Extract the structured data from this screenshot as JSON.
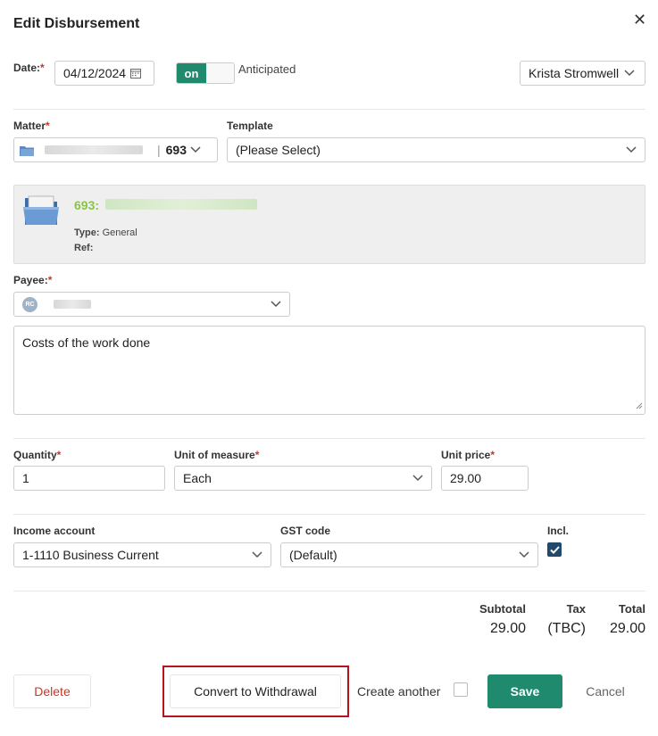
{
  "dialog": {
    "title": "Edit Disbursement"
  },
  "date": {
    "label": "Date:",
    "required": "*",
    "value": "04/12/2024"
  },
  "anticipated": {
    "toggle_label": "on",
    "label": "Anticipated"
  },
  "user_select": {
    "value": "Krista Stromwell"
  },
  "matter": {
    "label": "Matter",
    "required": "*",
    "number": "693"
  },
  "template": {
    "label": "Template",
    "value": "(Please Select)"
  },
  "matter_panel": {
    "code": "693:",
    "type_label": "Type:",
    "type_value": "General",
    "ref_label": "Ref:"
  },
  "payee": {
    "label": "Payee:",
    "required": "*",
    "avatar_initials": "RC"
  },
  "description": {
    "value": "Costs of the work done"
  },
  "quantity": {
    "label": "Quantity",
    "required": "*",
    "value": "1"
  },
  "unit_of_measure": {
    "label": "Unit of measure",
    "required": "*",
    "value": "Each"
  },
  "unit_price": {
    "label": "Unit price",
    "required": "*",
    "value": "29.00"
  },
  "income_account": {
    "label": "Income account",
    "value": "1-1110 Business Current"
  },
  "gst_code": {
    "label": "GST code",
    "value": "(Default)"
  },
  "incl": {
    "label": "Incl.",
    "checked": true
  },
  "totals": {
    "subtotal_label": "Subtotal",
    "subtotal_value": "29.00",
    "tax_label": "Tax",
    "tax_value": "(TBC)",
    "total_label": "Total",
    "total_value": "29.00"
  },
  "footer": {
    "delete_label": "Delete",
    "convert_label": "Convert to Withdrawal",
    "create_another_label": "Create another",
    "save_label": "Save",
    "cancel_label": "Cancel"
  },
  "colors": {
    "accent": "#1f8a6e",
    "danger": "#c0392b",
    "highlight_border": "#b5141f",
    "matter_code": "#8bc34a",
    "checkbox_checked": "#22486b"
  },
  "icons": [
    "close-icon",
    "calendar-icon",
    "chevron-down-icon",
    "folder-icon",
    "check-icon"
  ]
}
